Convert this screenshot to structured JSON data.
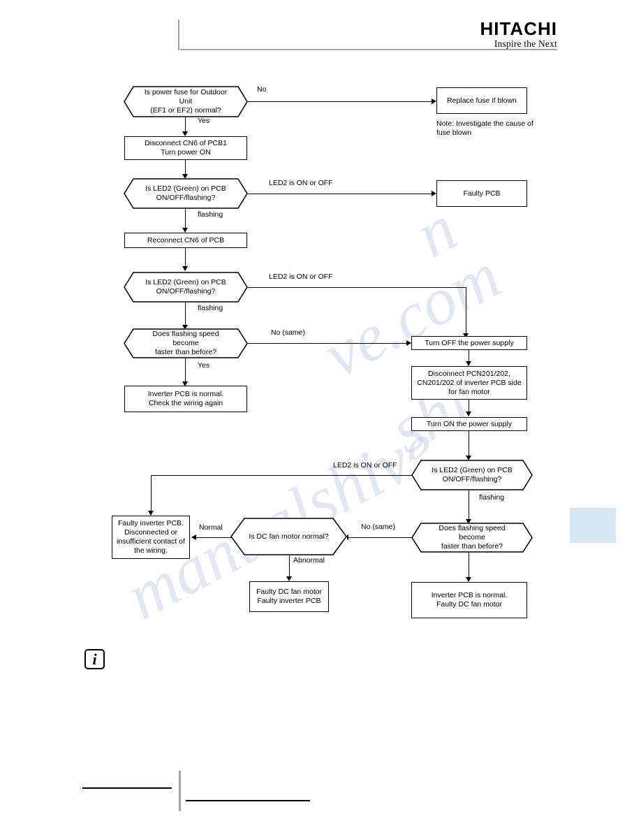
{
  "header": {
    "brand": "HITACHI",
    "tagline": "Inspire the Next"
  },
  "info_icon": {
    "glyph": "i",
    "name": "information-icon"
  },
  "note": {
    "text": "Note: Investigate the cause of\nfuse blown"
  },
  "side_tab": {
    "color": "#d6e6f2"
  },
  "chart_data": {
    "type": "diagram",
    "subtype": "flowchart",
    "title": "",
    "nodes": [
      {
        "id": "n1",
        "shape": "hexagon",
        "text": "Is power fuse for Outdoor Unit\n(EF1 or EF2) normal?"
      },
      {
        "id": "n2",
        "shape": "box",
        "text": "Replace fuse if blown"
      },
      {
        "id": "n3",
        "shape": "box",
        "text": "Disconnect CN6 of PCB1\nTurn power ON"
      },
      {
        "id": "n4",
        "shape": "hexagon",
        "text": "Is LED2 (Green) on PCB\nON/OFF/flashing?"
      },
      {
        "id": "n5",
        "shape": "box",
        "text": "Faulty PCB"
      },
      {
        "id": "n6",
        "shape": "box",
        "text": "Reconnect CN6 of PCB"
      },
      {
        "id": "n7",
        "shape": "hexagon",
        "text": "Is LED2 (Green) on PCB\nON/OFF/flashing?"
      },
      {
        "id": "n8",
        "shape": "hexagon",
        "text": "Does flashing speed become\nfaster than before?"
      },
      {
        "id": "n9",
        "shape": "box",
        "text": "Inverter PCB is normal.\nCheck the wiring again"
      },
      {
        "id": "n10",
        "shape": "box",
        "text": "Turn OFF the power supply"
      },
      {
        "id": "n11",
        "shape": "box",
        "text": "Disconnect PCN201/202,\nCN201/202 of inverter PCB side\nfor fan motor"
      },
      {
        "id": "n12",
        "shape": "box",
        "text": "Turn ON the power supply"
      },
      {
        "id": "n13",
        "shape": "hexagon",
        "text": "Is LED2 (Green) on PCB\nON/OFF/flashing?"
      },
      {
        "id": "n14",
        "shape": "hexagon",
        "text": "Does flashing speed become\nfaster than before?"
      },
      {
        "id": "n15",
        "shape": "box",
        "text": "Inverter PCB is normal.\nFaulty DC fan motor"
      },
      {
        "id": "n16",
        "shape": "hexagon",
        "text": "Is DC fan motor normal?"
      },
      {
        "id": "n17",
        "shape": "box",
        "text": "Faulty inverter PCB.\nDisconnected or\ninsufficient contact of\nthe wiring."
      },
      {
        "id": "n18",
        "shape": "box",
        "text": "Faulty DC fan motor\nFaulty inverter PCB"
      }
    ],
    "edges": [
      {
        "from": "n1",
        "to": "n2",
        "label": "No"
      },
      {
        "from": "n1",
        "to": "n3",
        "label": "Yes"
      },
      {
        "from": "n3",
        "to": "n4",
        "label": ""
      },
      {
        "from": "n4",
        "to": "n5",
        "label": "LED2 is ON or OFF"
      },
      {
        "from": "n4",
        "to": "n6",
        "label": "flashing"
      },
      {
        "from": "n6",
        "to": "n7",
        "label": ""
      },
      {
        "from": "n7",
        "to": "n10",
        "label": "LED2 is ON or OFF"
      },
      {
        "from": "n7",
        "to": "n8",
        "label": "flashing"
      },
      {
        "from": "n8",
        "to": "n10",
        "label": "No (same)"
      },
      {
        "from": "n8",
        "to": "n9",
        "label": "Yes"
      },
      {
        "from": "n10",
        "to": "n11",
        "label": ""
      },
      {
        "from": "n11",
        "to": "n12",
        "label": ""
      },
      {
        "from": "n12",
        "to": "n13",
        "label": ""
      },
      {
        "from": "n13",
        "to": "n17",
        "label": "LED2 is ON or OFF"
      },
      {
        "from": "n13",
        "to": "n14",
        "label": "flashing"
      },
      {
        "from": "n14",
        "to": "n16",
        "label": "No (same)"
      },
      {
        "from": "n14",
        "to": "n15",
        "label": ""
      },
      {
        "from": "n16",
        "to": "n17",
        "label": "Normal"
      },
      {
        "from": "n16",
        "to": "n18",
        "label": "Abnormal"
      }
    ]
  }
}
